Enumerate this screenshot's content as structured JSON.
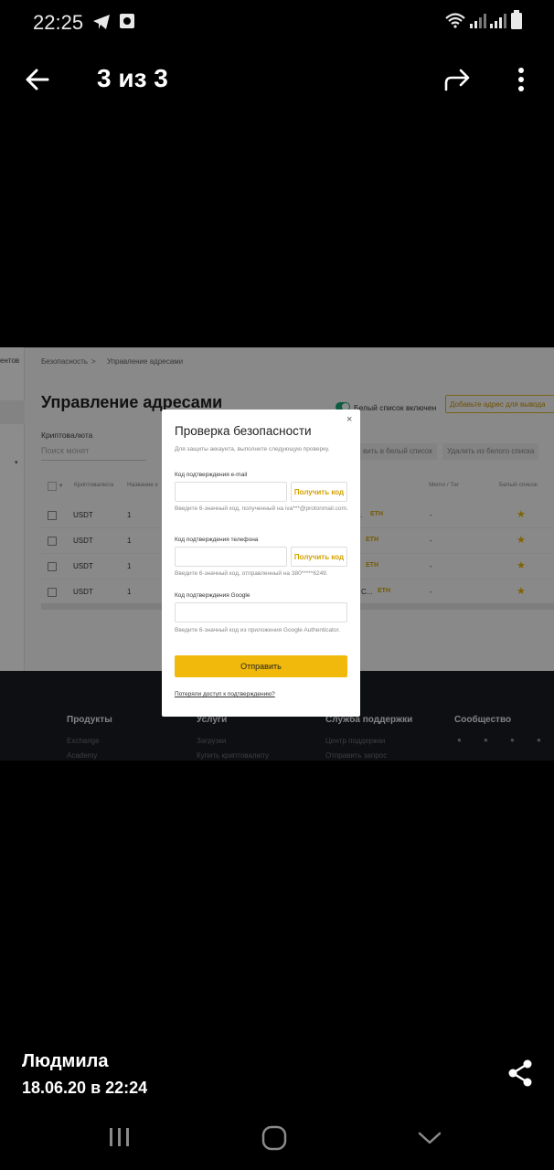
{
  "status_bar": {
    "time": "22:25"
  },
  "top_bar": {
    "counter": "3 из 3"
  },
  "photo": {
    "sidebar_text": "ентов",
    "breadcrumb": [
      "Безопасность",
      ">",
      "Управление адресами"
    ],
    "title": "Управление адресами",
    "whitelist_label": "Белый список включен",
    "add_address_button": "Добавьте адрес для вывода",
    "crypto_label": "Криптовалюта",
    "search_placeholder": "Поиск монет",
    "add_whitelist_button": "вить в белый список",
    "remove_whitelist_button": "Удалить из белого списка",
    "table": {
      "headers": [
        "Криптовалюта",
        "Название к",
        "Memo / Tег",
        "Белый список"
      ],
      "rows": [
        {
          "coin": "USDT",
          "name": "1",
          "addr": "...",
          "network": "ETH",
          "memo": "-",
          "star": "★"
        },
        {
          "coin": "USDT",
          "name": "1",
          "addr": "",
          "network": "ETH",
          "memo": "-",
          "star": "★"
        },
        {
          "coin": "USDT",
          "name": "1",
          "addr": "",
          "network": "ETH",
          "memo": "-",
          "star": "★"
        },
        {
          "coin": "USDT",
          "name": "1",
          "addr": "C...",
          "network": "ETH",
          "memo": "-",
          "star": "★"
        }
      ]
    },
    "footer": {
      "columns": [
        {
          "heading": "Продукты",
          "links": [
            "Exchange",
            "Academy"
          ]
        },
        {
          "heading": "Услуги",
          "links": [
            "Загрузки",
            "Купить криптовалюту"
          ]
        },
        {
          "heading": "Служба поддержки",
          "links": [
            "Центр поддержки",
            "Отправить запрос"
          ]
        },
        {
          "heading": "Сообщество",
          "links": []
        }
      ]
    },
    "modal": {
      "title": "Проверка безопасности",
      "close": "×",
      "subtitle": "Для защиты аккаунта, выполните следующую проверку.",
      "email_label": "Код подтверждения e-mail",
      "email_get_code": "Получить код",
      "email_hint": "Введите 6-значный код, полученный на iva***@protonmail.com.",
      "phone_label": "Код подтверждения телефона",
      "phone_get_code": "Получить код",
      "phone_hint": "Введите 6-значный код, отправленный на 380*****6249.",
      "google_label": "Код подтверждения Google",
      "google_hint": "Введите 6-значный код из приложения Google Authenticator.",
      "submit": "Отправить",
      "lost_access": "Потеряли доступ к подтверждению?"
    }
  },
  "caption": {
    "sender": "Людмила",
    "date": "18.06.20 в 22:24"
  }
}
